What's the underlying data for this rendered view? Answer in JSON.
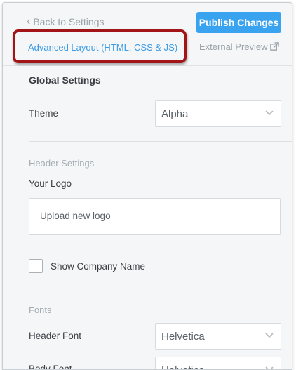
{
  "header": {
    "back_label": "Back to Settings",
    "publish_label": "Publish Changes",
    "advanced_layout_label": "Advanced Layout (HTML, CSS & JS)",
    "external_preview_label": "External Preview"
  },
  "global_settings": {
    "title": "Global Settings",
    "theme_label": "Theme",
    "theme_value": "Alpha"
  },
  "header_settings": {
    "title": "Header Settings",
    "logo_label": "Your Logo",
    "upload_label": "Upload new logo",
    "show_company_label": "Show Company Name",
    "show_company_checked": false
  },
  "fonts": {
    "title": "Fonts",
    "header_font_label": "Header Font",
    "header_font_value": "Helvetica",
    "body_font_label": "Body Font",
    "body_font_value": "Helvetica"
  },
  "colors": {
    "accent": "#3aa3f0",
    "highlight_border": "#a31419",
    "link": "#3a9be6"
  },
  "icons": {
    "back": "chevron-left-icon",
    "external": "external-link-icon",
    "dropdown": "chevron-down-icon"
  }
}
